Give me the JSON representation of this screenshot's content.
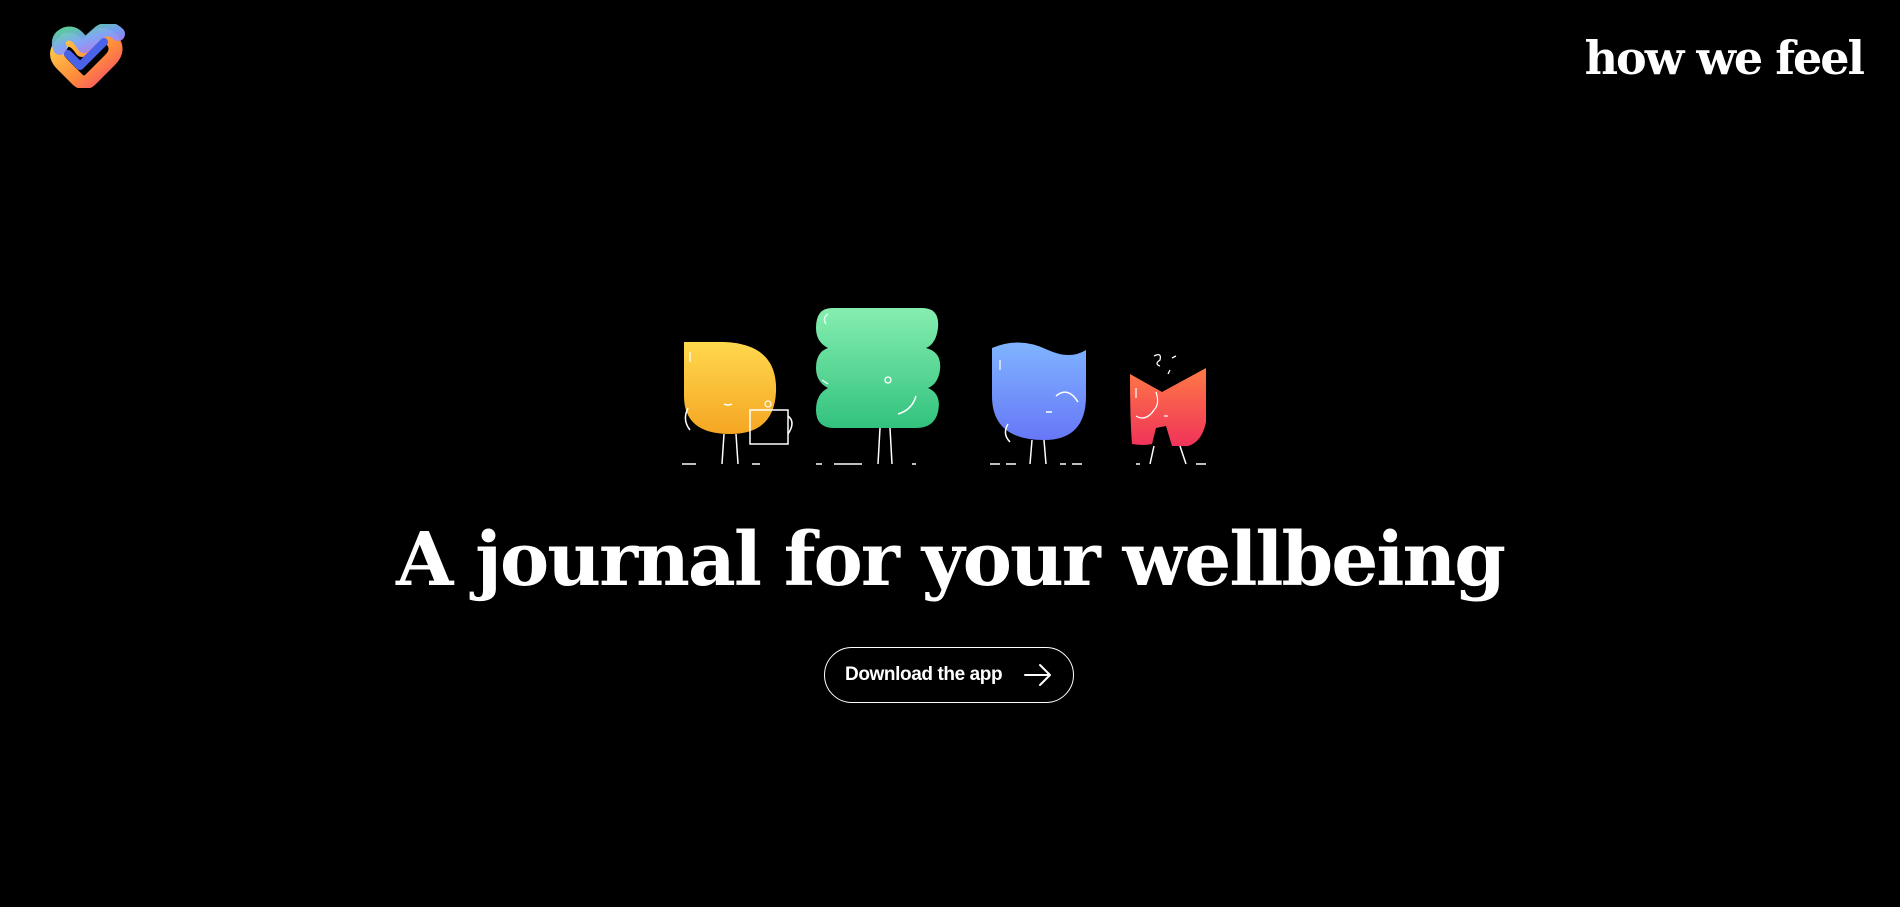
{
  "header": {
    "logo_icon": "heart-checkmark-icon",
    "wordmark": "how we feel"
  },
  "hero": {
    "illustration": {
      "characters": [
        {
          "name": "yellow-character",
          "color_top": "#FFD84D",
          "color_bottom": "#F5A623",
          "icon": "yellow-blob-character-icon"
        },
        {
          "name": "green-character",
          "color_top": "#86EEB0",
          "color_bottom": "#32C27E",
          "icon": "green-blob-character-icon"
        },
        {
          "name": "blue-character",
          "color_top": "#7FB4FF",
          "color_bottom": "#6777F7",
          "icon": "blue-blob-character-icon"
        },
        {
          "name": "red-character",
          "color_top": "#FF7A45",
          "color_bottom": "#F0335A",
          "icon": "red-blob-character-icon"
        }
      ]
    },
    "headline": "A journal for your wellbeing",
    "cta": {
      "label": "Download the app",
      "icon": "arrow-right-icon"
    }
  },
  "colors": {
    "background": "#000000",
    "text": "#FFFFFF"
  }
}
